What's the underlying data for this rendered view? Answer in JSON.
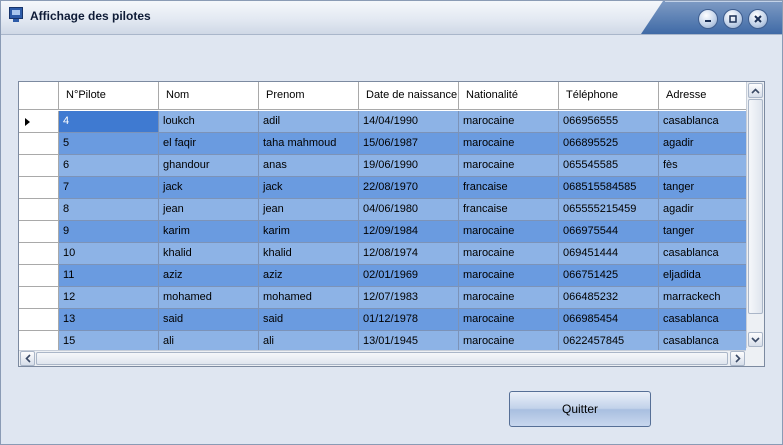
{
  "window": {
    "title": "Affichage des pilotes",
    "accent_color": "#3f6aa6",
    "controls": [
      {
        "name": "minimize-button",
        "icon": "minimize-icon"
      },
      {
        "name": "maximize-button",
        "icon": "maximize-icon"
      },
      {
        "name": "close-button",
        "icon": "close-icon"
      }
    ]
  },
  "grid": {
    "columns": [
      "N°Pilote",
      "Nom",
      "Prenom",
      "Date de naissance",
      "Nationalité",
      "Téléphone",
      "Adresse"
    ],
    "rows": [
      [
        "4",
        "loukch",
        "adil",
        "14/04/1990",
        "marocaine",
        "066956555",
        "casablanca"
      ],
      [
        "5",
        "el faqir",
        "taha mahmoud",
        "15/06/1987",
        "marocaine",
        "066895525",
        "agadir"
      ],
      [
        "6",
        "ghandour",
        "anas",
        "19/06/1990",
        "marocaine",
        "065545585",
        "fès"
      ],
      [
        "7",
        "jack",
        "jack",
        "22/08/1970",
        "francaise",
        "068515584585",
        "tanger"
      ],
      [
        "8",
        "jean",
        "jean",
        "04/06/1980",
        "francaise",
        "065555215459",
        "agadir"
      ],
      [
        "9",
        "karim",
        "karim",
        "12/09/1984",
        "marocaine",
        "066975544",
        "tanger"
      ],
      [
        "10",
        "khalid",
        "khalid",
        "12/08/1974",
        "marocaine",
        "069451444",
        "casablanca"
      ],
      [
        "11",
        "aziz",
        "aziz",
        "02/01/1969",
        "marocaine",
        "066751425",
        "eljadida"
      ],
      [
        "12",
        "mohamed",
        "mohamed",
        "12/07/1983",
        "marocaine",
        "066485232",
        "marrackech"
      ],
      [
        "13",
        "said",
        "said",
        "01/12/1978",
        "marocaine",
        "066985454",
        "casablanca"
      ],
      [
        "15",
        "ali",
        "ali",
        "13/01/1945",
        "marocaine",
        "0622457845",
        "casablanca"
      ]
    ],
    "selected_row_index": 0,
    "row_colors": {
      "odd": "#8db3e6",
      "even": "#6a9be0",
      "selected": "#3f7ad1"
    }
  },
  "actions": {
    "quit_label": "Quitter"
  }
}
